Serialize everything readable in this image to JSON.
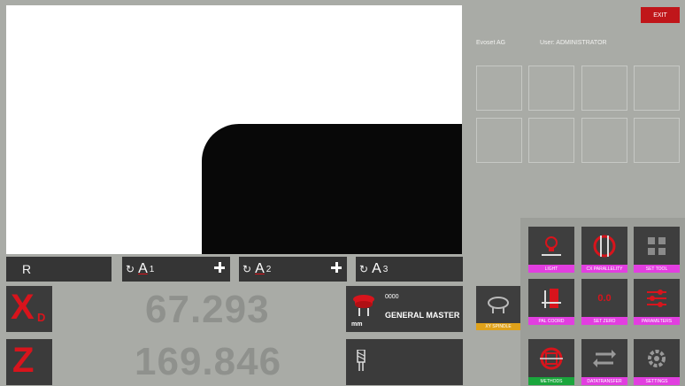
{
  "header": {
    "exit_label": "EXIT",
    "company": "Evoset AG",
    "user": "User: ADMINISTRATOR"
  },
  "tabs": {
    "r_label": "R",
    "a1_label": "A",
    "a1_sub": "1",
    "a2_label": "A",
    "a2_sub": "2",
    "a3_label": "A",
    "a3_sub": "3",
    "rotate_glyph": "↻"
  },
  "axes": {
    "x_label": "X",
    "x_sub": "D",
    "x_value": "67.293",
    "z_label": "Z",
    "z_value": "169.846"
  },
  "tool": {
    "number": "0000",
    "name": "GENERAL MASTER",
    "unit": "mm"
  },
  "spindle": {
    "label": "XY SPINDLE"
  },
  "tiles": {
    "light": "LIGHT",
    "parallelity": "CX PARALLELITY",
    "set_tool": "SET TOOL",
    "pal_coord": "PAL COORD",
    "set_zero": "SET ZERO",
    "set_zero_value": "0.0",
    "parameters": "PARAMETERS",
    "methods": "METHODS",
    "datatransfer": "DATATRANSFER",
    "settings": "SETTINGS"
  },
  "colors": {
    "accent_red": "#d8141c",
    "label_pink": "#e23ee0",
    "label_green": "#1aa63c",
    "label_yellow": "#e0a21a",
    "tile_dark": "#3e3e3e"
  }
}
